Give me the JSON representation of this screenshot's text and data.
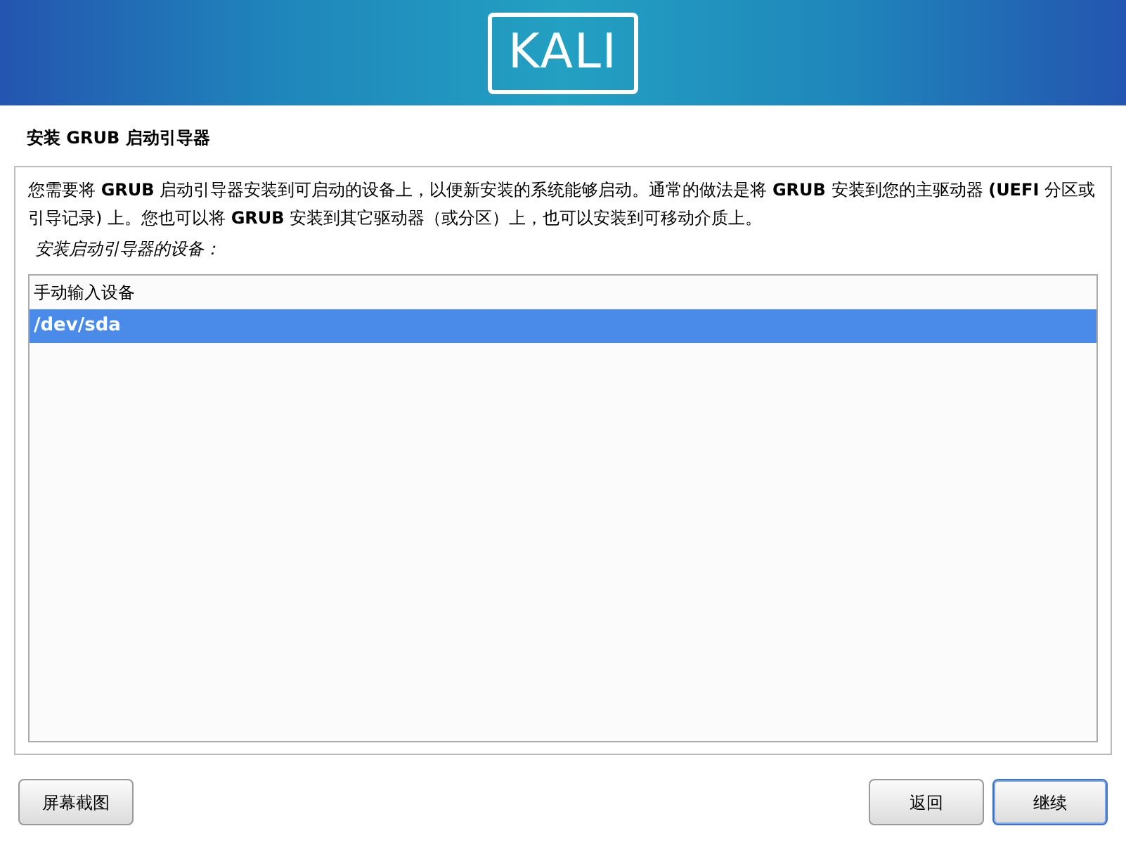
{
  "header": {
    "logo": "KALI"
  },
  "title": "安装 GRUB 启动引导器",
  "description": "您需要将 **GRUB** 启动引导器安装到可启动的设备上，以便新安装的系统能够启动。通常的做法是将 **GRUB** 安装到您的主驱动器 **(UEFI** 分区或引导记录) 上。您也可以将 **GRUB** 安装到其它驱动器（或分区）上，也可以安装到可移动介质上。",
  "prompt": "安装启动引导器的设备：",
  "devices": [
    {
      "label": "手动输入设备",
      "selected": false
    },
    {
      "label": "/dev/sda",
      "selected": true
    }
  ],
  "left_buttons": [
    {
      "label": "屏幕截图",
      "focused": false
    }
  ],
  "right_buttons": [
    {
      "label": "返回",
      "focused": false
    },
    {
      "label": "继续",
      "focused": true
    }
  ]
}
